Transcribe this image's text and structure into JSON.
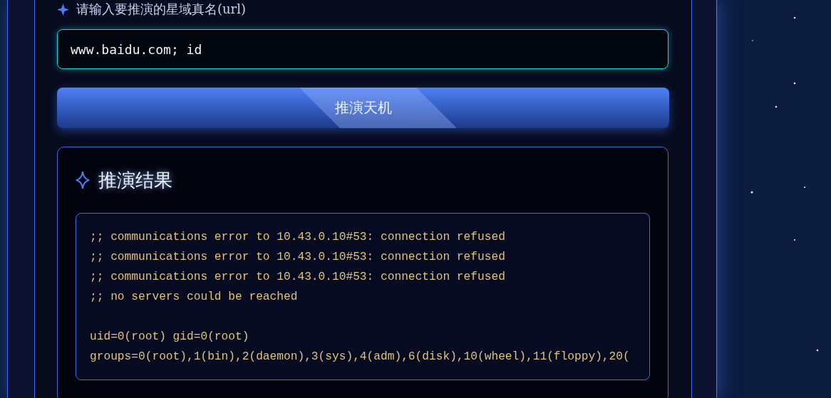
{
  "form": {
    "label": "请输入要推演的星域真名(url)",
    "input": {
      "value": "www.baidu.com; id"
    },
    "button": "推演天机"
  },
  "result": {
    "title": "推演结果",
    "blocks": [
      [
        ";; communications error to 10.43.0.10#53: connection refused",
        ";; communications error to 10.43.0.10#53: connection refused",
        ";; communications error to 10.43.0.10#53: connection refused",
        ";; no servers could be reached"
      ],
      [
        "uid=0(root) gid=0(root)",
        "groups=0(root),1(bin),2(daemon),3(sys),4(adm),6(disk),10(wheel),11(floppy),20("
      ]
    ]
  }
}
